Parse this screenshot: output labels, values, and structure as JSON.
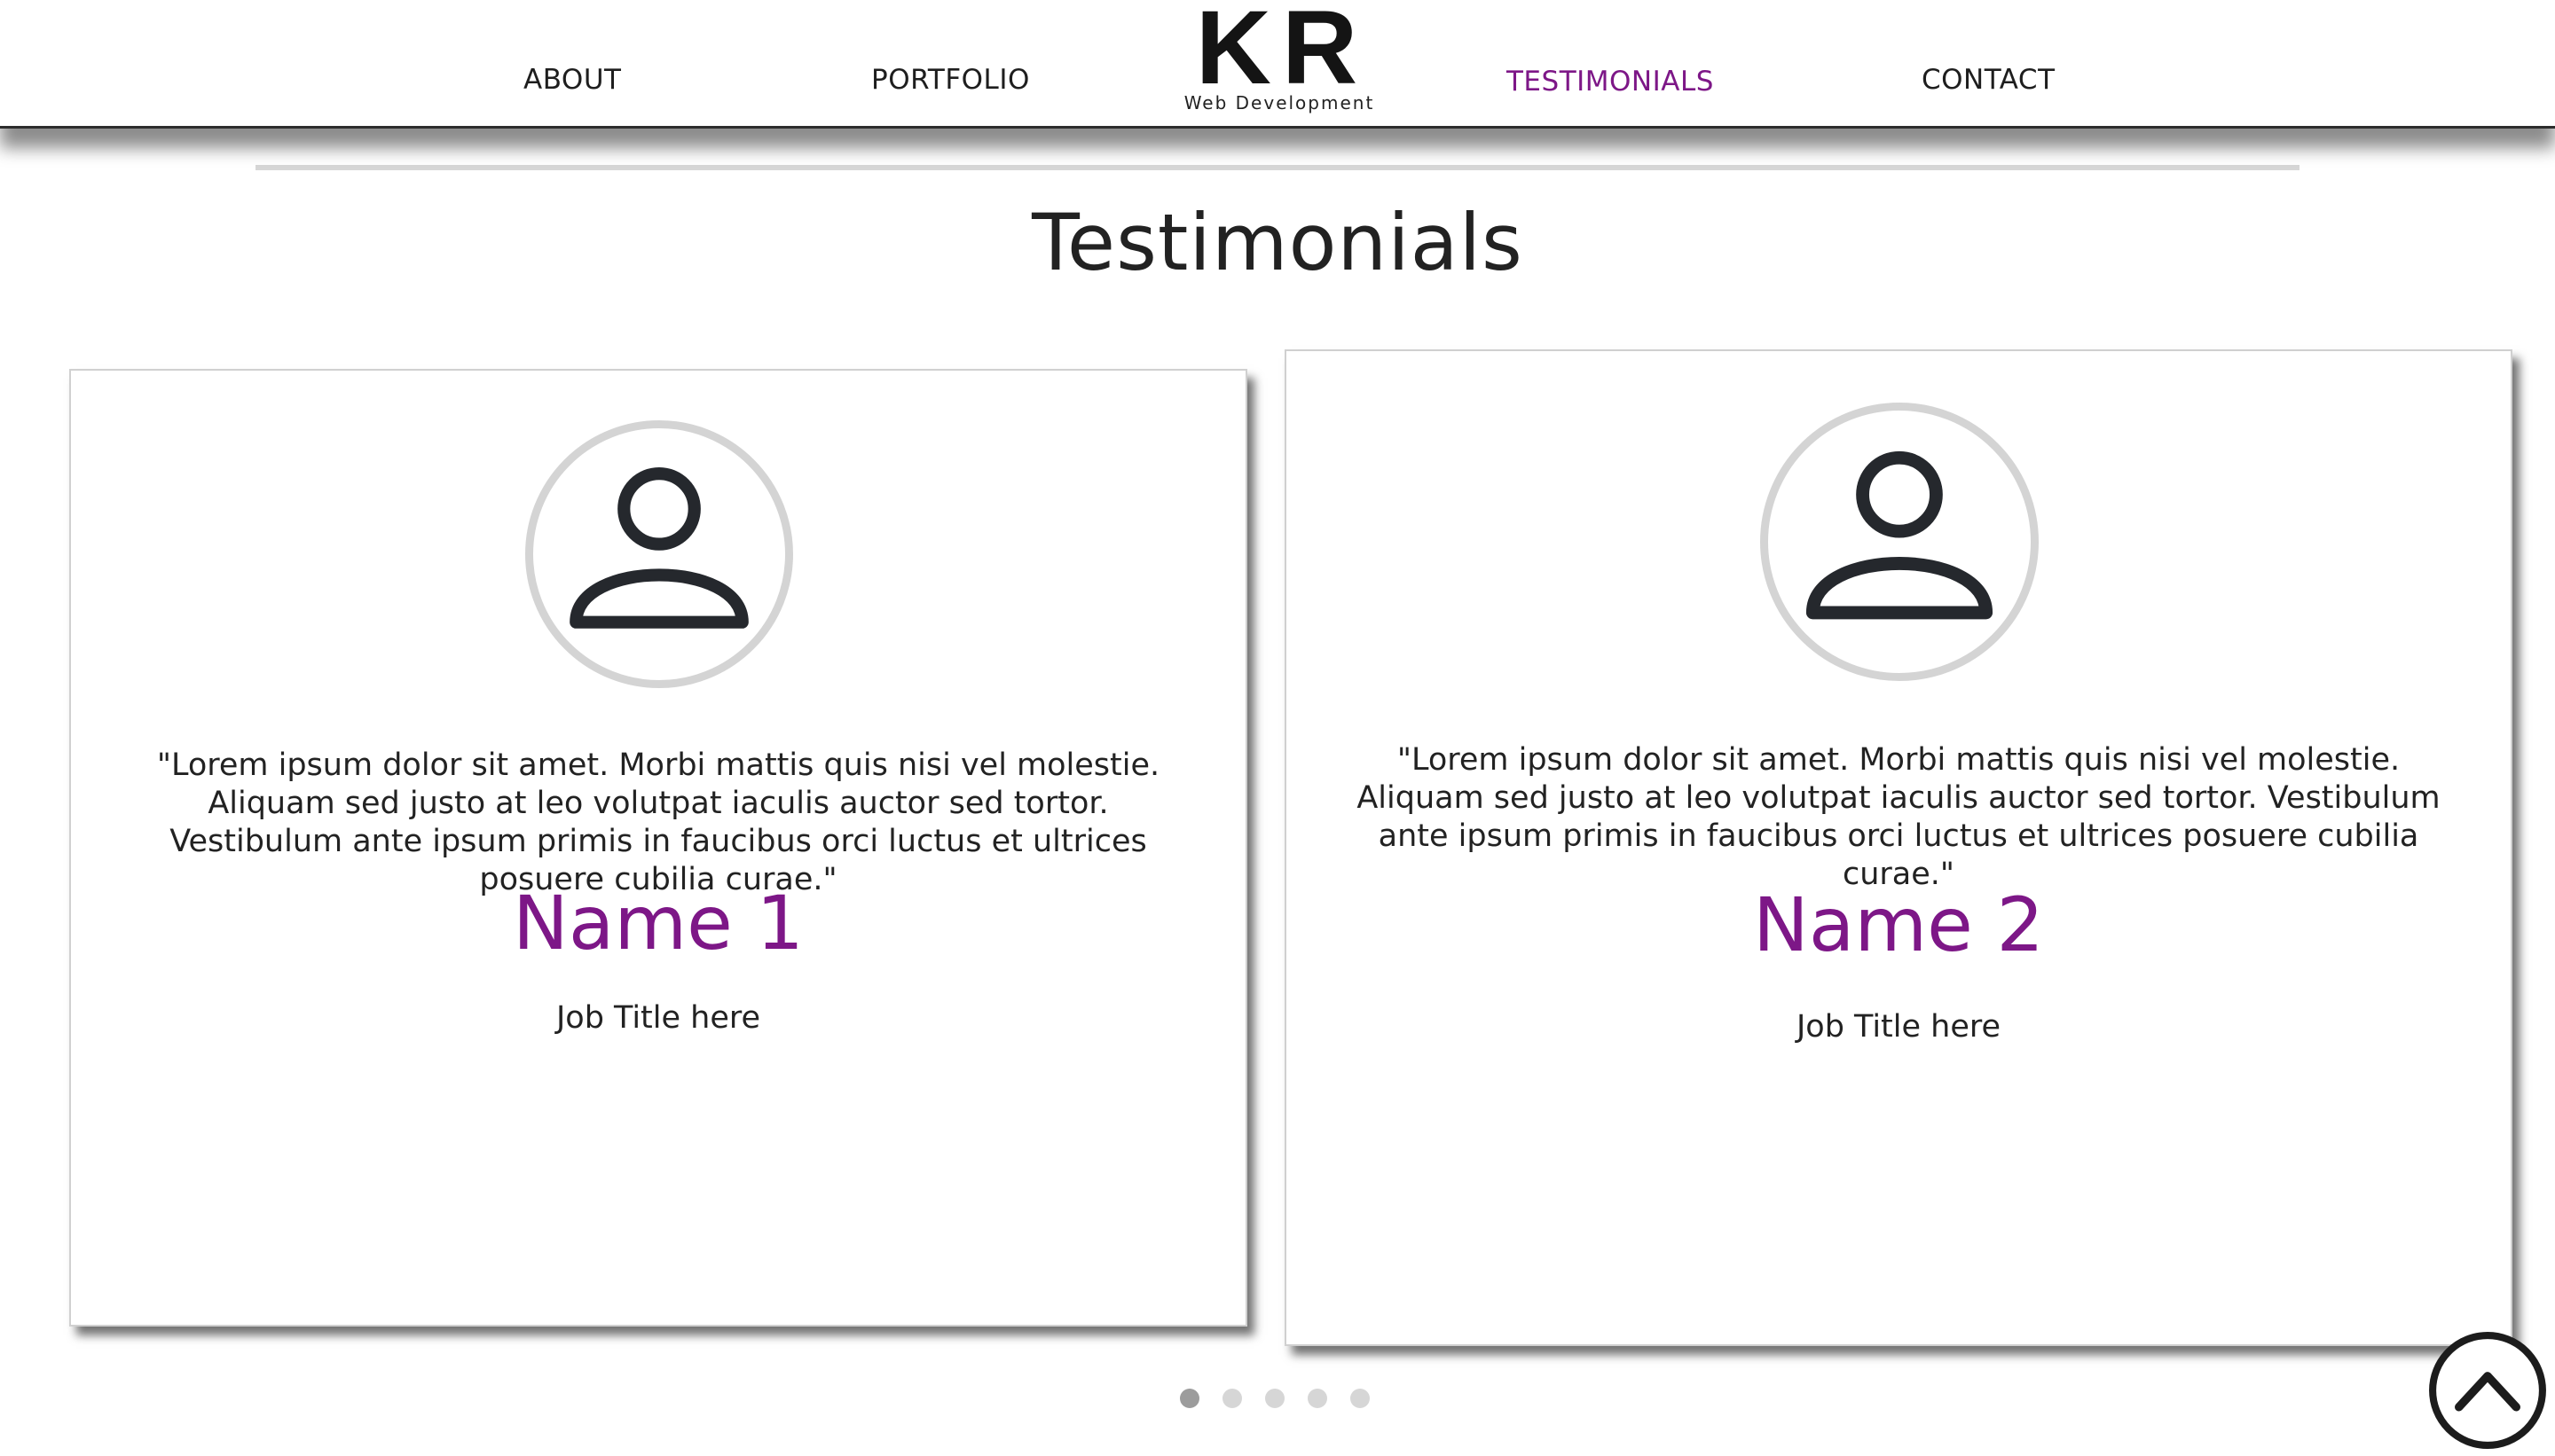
{
  "nav": {
    "items": [
      {
        "label": "ABOUT"
      },
      {
        "label": "PORTFOLIO"
      },
      {
        "label": "TESTIMONIALS",
        "active": true
      },
      {
        "label": "CONTACT"
      }
    ],
    "logo": {
      "mark": "KR",
      "subtitle": "Web Development"
    }
  },
  "section": {
    "title": "Testimonials"
  },
  "testimonials": [
    {
      "quote": "\"Lorem ipsum dolor sit amet. Morbi mattis quis nisi vel molestie. Aliquam sed justo at leo volutpat iaculis auctor sed tortor. Vestibulum ante ipsum primis in faucibus orci luctus et ultrices posuere cubilia curae.\"",
      "name": "Name 1",
      "job_title": "Job Title here",
      "avatar_icon": "user-icon"
    },
    {
      "quote": "\"Lorem ipsum dolor sit amet. Morbi mattis quis nisi vel molestie. Aliquam sed justo at leo volutpat iaculis auctor sed tortor. Vestibulum ante ipsum primis in faucibus orci luctus et ultrices posuere cubilia curae.\"",
      "name": "Name 2",
      "job_title": "Job Title here",
      "avatar_icon": "user-icon"
    }
  ],
  "carousel": {
    "slide_count": 5,
    "active_index": 0
  },
  "back_to_top_icon": "chevron-up-circle-icon",
  "colors": {
    "accent": "#7d1787",
    "text": "#222222",
    "divider": "#d6d6d6"
  }
}
